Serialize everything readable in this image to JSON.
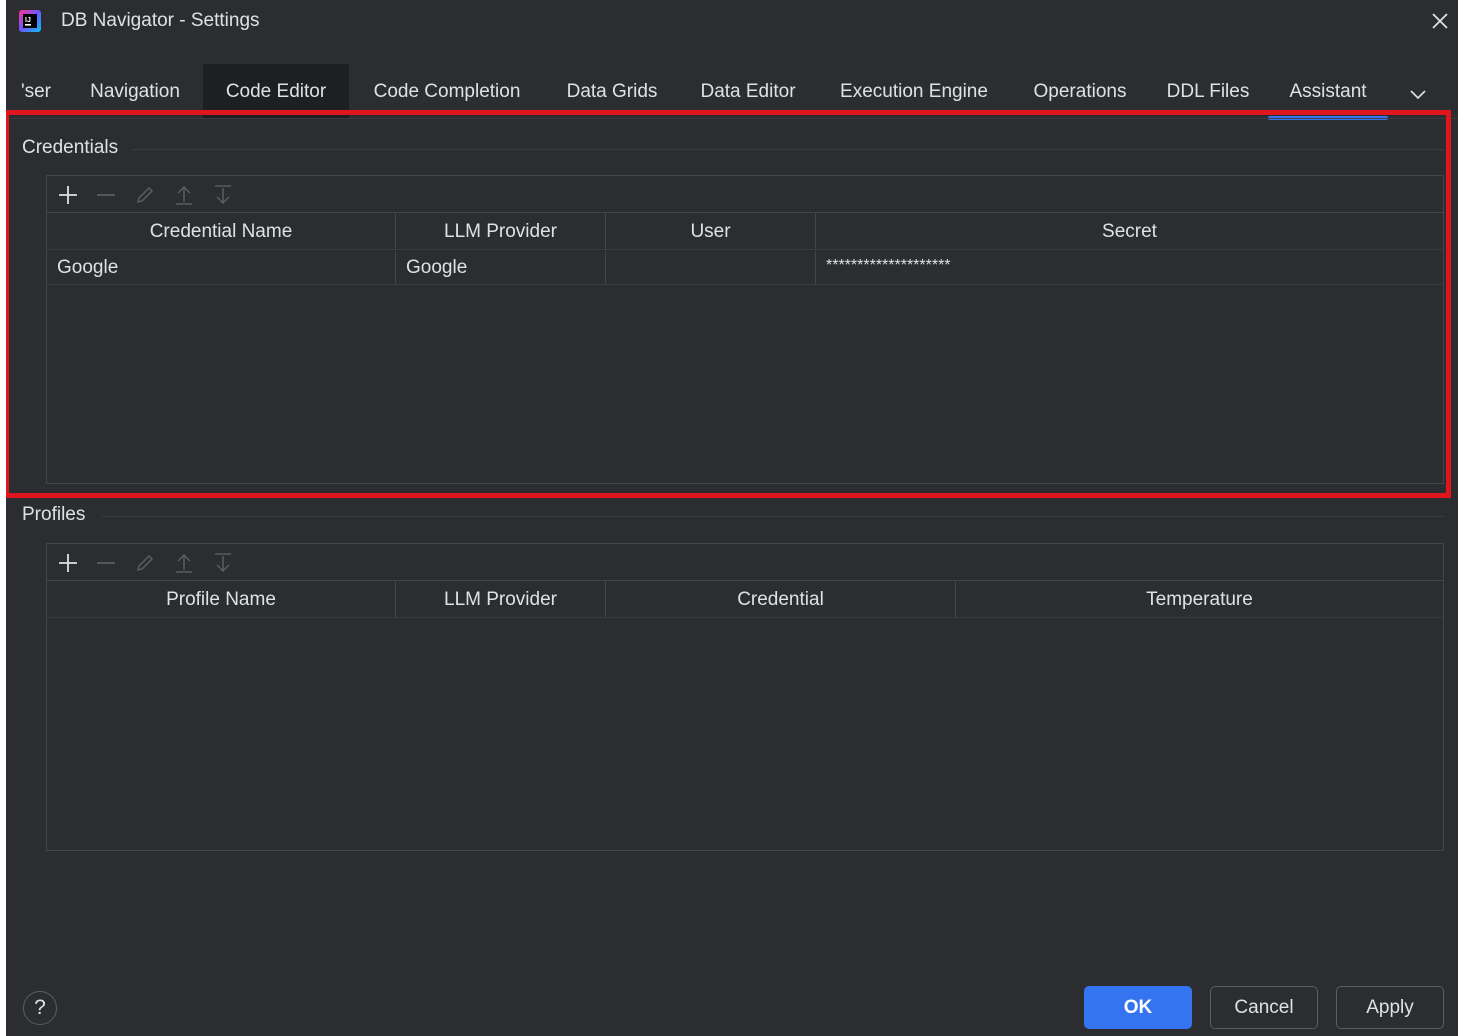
{
  "window": {
    "title": "DB Navigator - Settings"
  },
  "tabs": [
    {
      "label": "'ser"
    },
    {
      "label": "Navigation"
    },
    {
      "label": "Code Editor"
    },
    {
      "label": "Code Completion"
    },
    {
      "label": "Data Grids"
    },
    {
      "label": "Data Editor"
    },
    {
      "label": "Execution Engine"
    },
    {
      "label": "Operations"
    },
    {
      "label": "DDL Files"
    },
    {
      "label": "Assistant"
    }
  ],
  "active_tab": "Assistant",
  "credentials": {
    "title": "Credentials",
    "columns": [
      "Credential Name",
      "LLM Provider",
      "User",
      "Secret"
    ],
    "rows": [
      {
        "name": "Google",
        "provider": "Google",
        "user": "",
        "secret": "********************"
      }
    ]
  },
  "profiles": {
    "title": "Profiles",
    "columns": [
      "Profile Name",
      "LLM Provider",
      "Credential",
      "Temperature"
    ],
    "rows": []
  },
  "buttons": {
    "help": "?",
    "ok": "OK",
    "cancel": "Cancel",
    "apply": "Apply"
  },
  "colors": {
    "background": "#2b2d30",
    "accent": "#3574f0",
    "highlight": "#e0161d",
    "text": "#dfe1e5"
  },
  "icons": [
    "app-logo-icon",
    "close-icon",
    "chevron-down-icon",
    "plus-icon",
    "minus-icon",
    "edit-icon",
    "move-up-icon",
    "move-down-icon",
    "help-icon"
  ]
}
